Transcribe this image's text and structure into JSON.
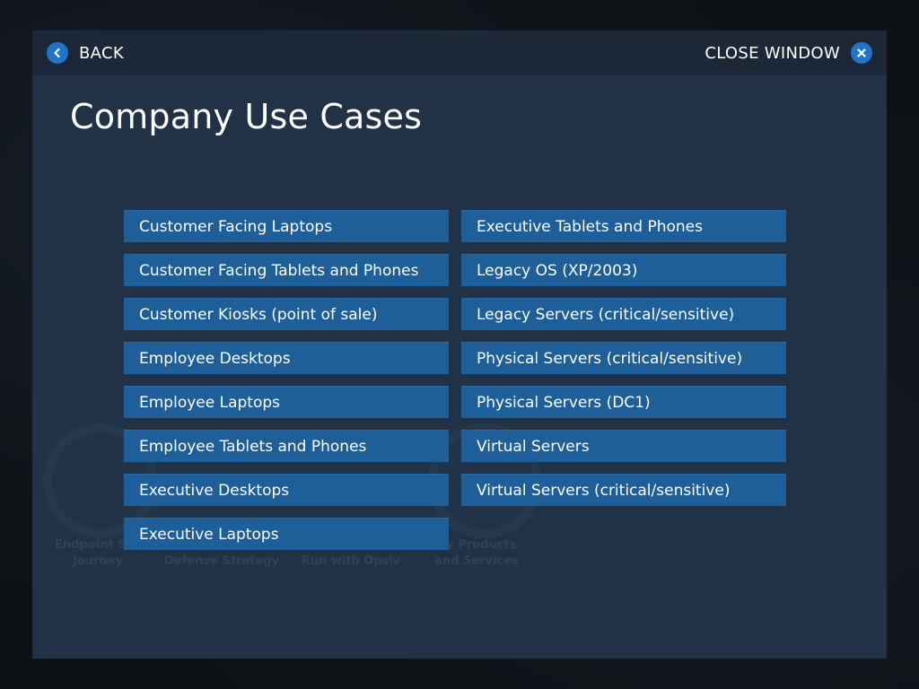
{
  "header": {
    "back_label": "BACK",
    "close_label": "CLOSE WINDOW"
  },
  "page": {
    "title": "Company Use Cases"
  },
  "background_labels": [
    "Endpoint Sec",
    "Journey",
    "Defense Strategy",
    "Run with Opsiv",
    "ity Products",
    "and Services"
  ],
  "use_cases": {
    "left": [
      "Customer Facing Laptops",
      "Customer Facing Tablets and Phones",
      "Customer Kiosks (point of sale)",
      "Employee Desktops",
      "Employee Laptops",
      "Employee Tablets and Phones",
      "Executive Desktops",
      "Executive Laptops"
    ],
    "right": [
      "Executive Tablets and Phones",
      "Legacy OS (XP/2003)",
      "Legacy Servers (critical/sensitive)",
      "Physical Servers (critical/sensitive)",
      "Physical Servers (DC1)",
      "Virtual Servers",
      "Virtual Servers (critical/sensitive)"
    ]
  },
  "colors": {
    "modal_bg": "#223246",
    "header_bg": "#1c2837",
    "button_bg": "#1e5f99",
    "icon_bg": "#2374c6"
  },
  "icons": {
    "back": "chevron-left-icon",
    "close": "close-icon"
  }
}
